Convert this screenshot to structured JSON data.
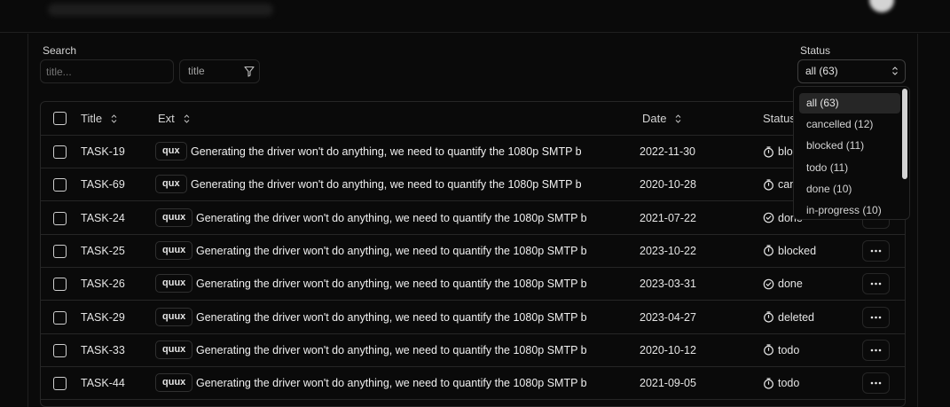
{
  "filters": {
    "search_label": "Search",
    "search_placeholder": "title...",
    "column_filter_value": "title",
    "status_label": "Status",
    "status_selected": "all (63)"
  },
  "table": {
    "headers": {
      "title": "Title",
      "ext": "Ext",
      "date": "Date",
      "status": "Status"
    },
    "rows": [
      {
        "task": "TASK-19",
        "ext": "qux",
        "title": "Generating the driver won't do anything, we need to quantify the 1080p SMTP bandw...",
        "date": "2022-11-30",
        "status": "blocked",
        "status_icon": "timer-icon"
      },
      {
        "task": "TASK-69",
        "ext": "qux",
        "title": "Generating the driver won't do anything, we need to quantify the 1080p SMTP bandw...",
        "date": "2020-10-28",
        "status": "cancelled",
        "status_icon": "timer-icon"
      },
      {
        "task": "TASK-24",
        "ext": "quux",
        "title": "Generating the driver won't do anything, we need to quantify the 1080p SMTP bandw...",
        "date": "2021-07-22",
        "status": "done",
        "status_icon": "check-circle-icon"
      },
      {
        "task": "TASK-25",
        "ext": "quux",
        "title": "Generating the driver won't do anything, we need to quantify the 1080p SMTP bandw...",
        "date": "2023-10-22",
        "status": "blocked",
        "status_icon": "timer-icon"
      },
      {
        "task": "TASK-26",
        "ext": "quux",
        "title": "Generating the driver won't do anything, we need to quantify the 1080p SMTP bandw...",
        "date": "2023-03-31",
        "status": "done",
        "status_icon": "check-circle-icon"
      },
      {
        "task": "TASK-29",
        "ext": "quux",
        "title": "Generating the driver won't do anything, we need to quantify the 1080p SMTP bandw...",
        "date": "2023-04-27",
        "status": "deleted",
        "status_icon": "timer-icon"
      },
      {
        "task": "TASK-33",
        "ext": "quux",
        "title": "Generating the driver won't do anything, we need to quantify the 1080p SMTP bandw...",
        "date": "2020-10-12",
        "status": "todo",
        "status_icon": "timer-icon"
      },
      {
        "task": "TASK-44",
        "ext": "quux",
        "title": "Generating the driver won't do anything, we need to quantify the 1080p SMTP bandw...",
        "date": "2021-09-05",
        "status": "todo",
        "status_icon": "timer-icon"
      }
    ]
  },
  "status_dropdown": {
    "options": [
      "all (63)",
      "cancelled (12)",
      "blocked (11)",
      "todo (11)",
      "done (10)",
      "in-progress (10)"
    ],
    "highlighted": "all (63)"
  }
}
